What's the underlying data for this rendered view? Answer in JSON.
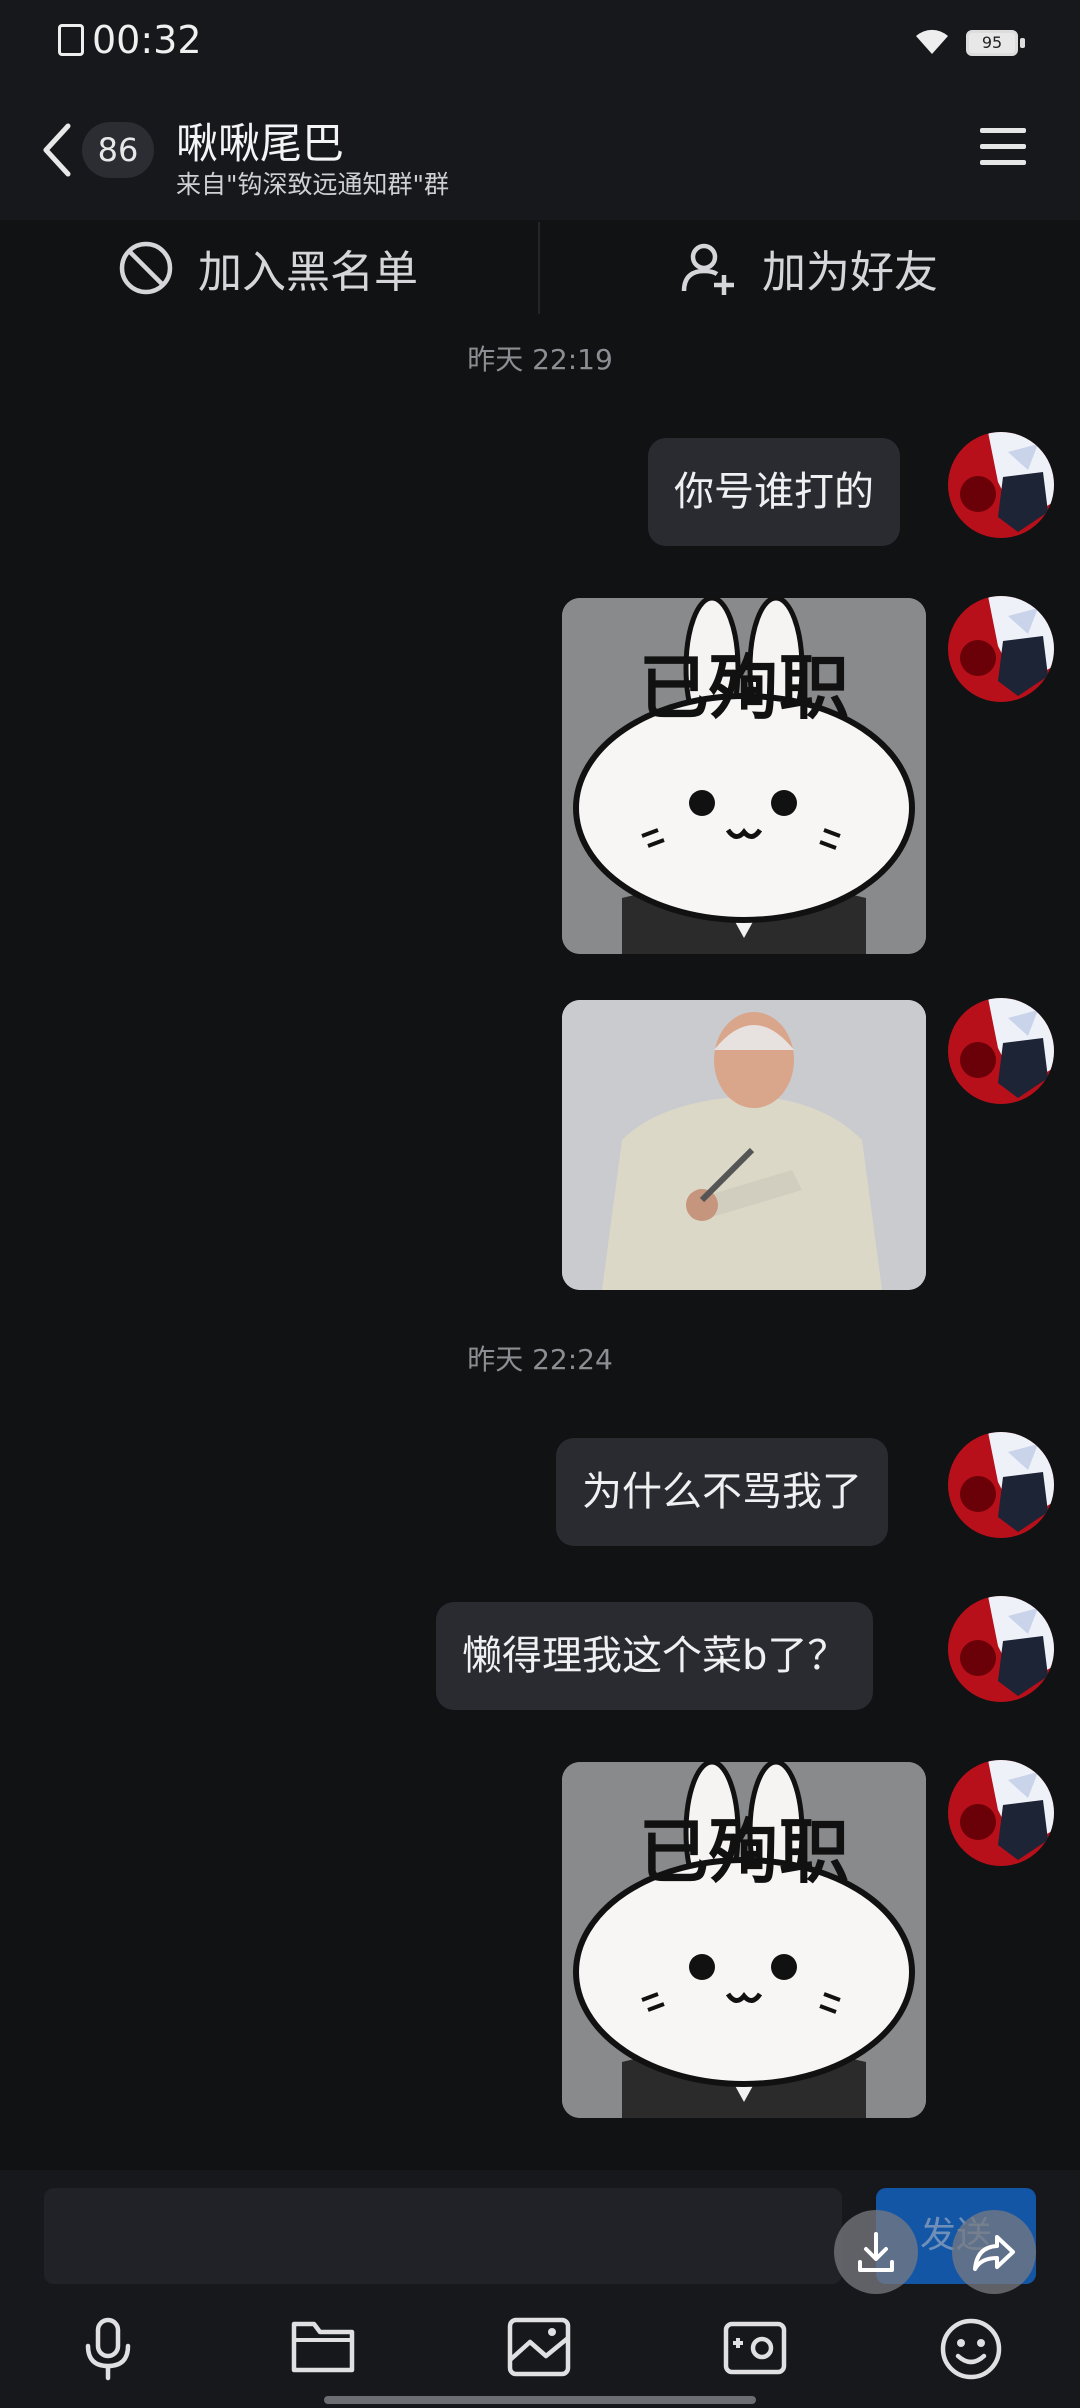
{
  "status_bar": {
    "time": "00:32",
    "battery": "95"
  },
  "header": {
    "unread_count": "86",
    "title": "啾啾尾巴",
    "subtitle": "来自\"钩深致远通知群\"群"
  },
  "actions": {
    "block_label": "加入黑名单",
    "add_friend_label": "加为好友"
  },
  "timestamps": [
    "昨天 22:19",
    "昨天 22:24"
  ],
  "messages": {
    "m1": "你号谁打的",
    "sticker1_text": "已殉职",
    "m2": "为什么不骂我了",
    "m3": "懒得理我这个菜b了？",
    "sticker2_text": "已殉职"
  },
  "input": {
    "placeholder": "",
    "send_label": "发送"
  },
  "colors": {
    "background": "#111214",
    "bubble": "#2a2b30",
    "send": "#1456a6"
  }
}
